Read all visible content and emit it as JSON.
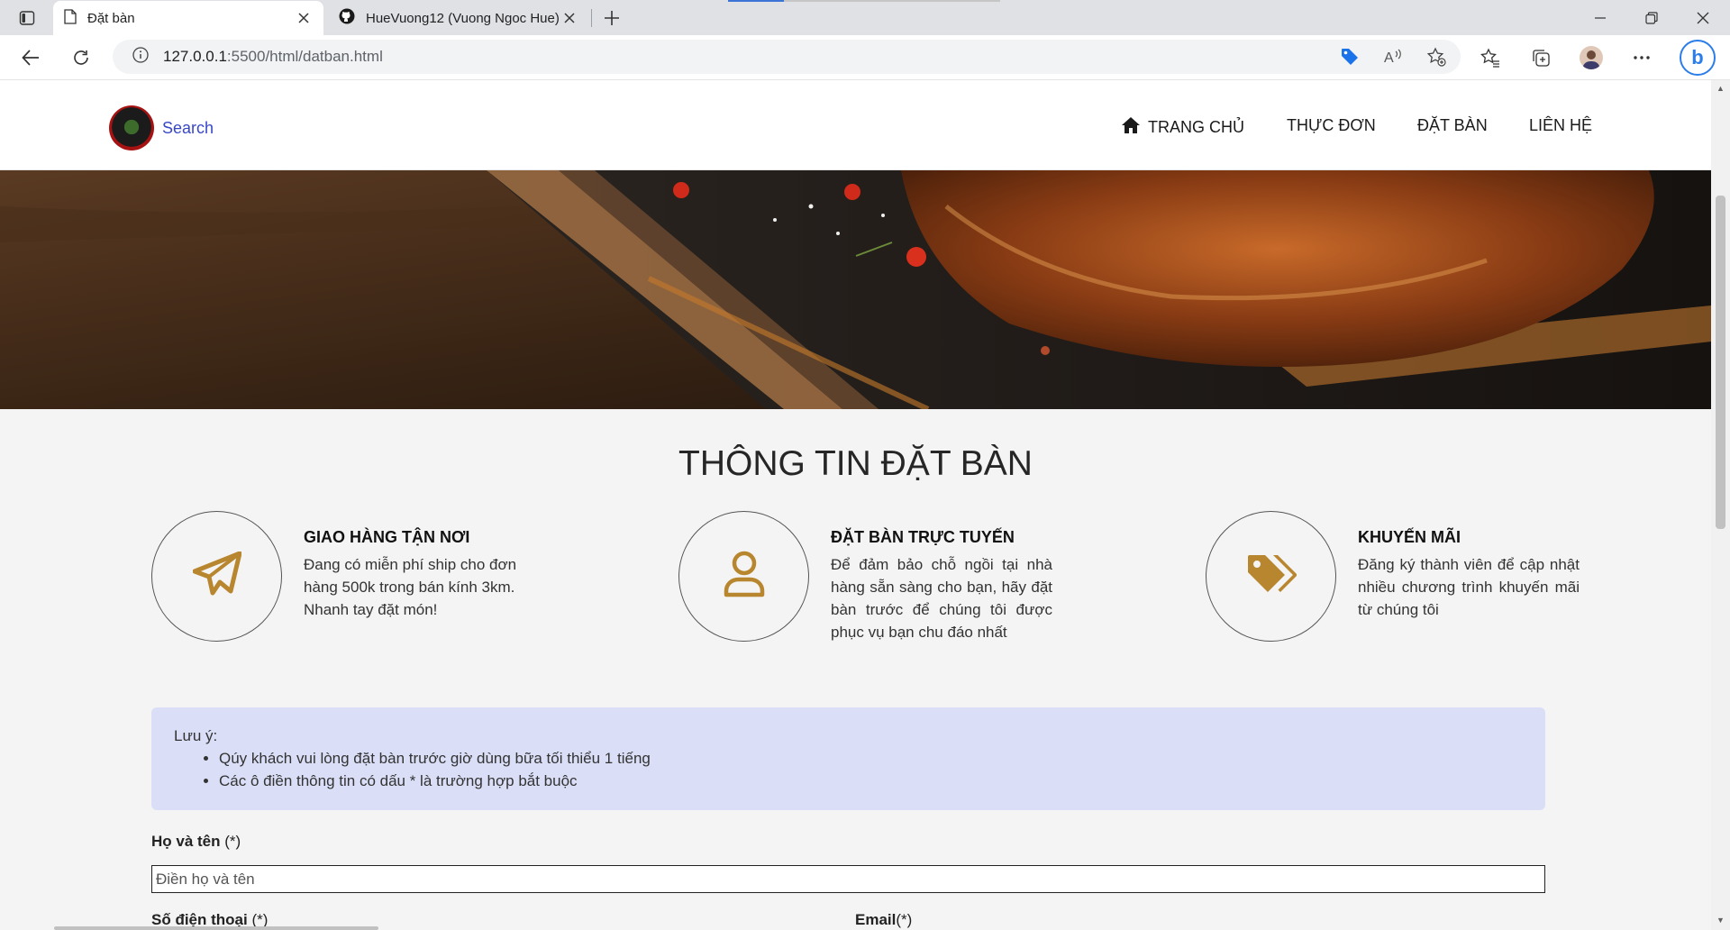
{
  "browser": {
    "tabs": [
      {
        "title": "Đặt bàn",
        "active": true
      },
      {
        "title": "HueVuong12 (Vuong Ngoc Hue)",
        "active": false
      }
    ],
    "url_host": "127.0.0.1",
    "url_path": ":5500/html/datban.html"
  },
  "site": {
    "logo_text": "Search",
    "nav": [
      "TRANG CHỦ",
      "THỰC ĐƠN",
      "ĐẶT BÀN",
      "LIÊN HỆ"
    ]
  },
  "section_title": "THÔNG TIN ĐẶT BÀN",
  "features": [
    {
      "icon": "paper-plane-icon",
      "title": "GIAO HÀNG TẬN NƠI",
      "desc": "Đang có miễn phí ship cho đơn hàng 500k trong bán kính 3km. Nhanh tay đặt món!"
    },
    {
      "icon": "user-icon",
      "title": "ĐẶT BÀN TRỰC TUYẾN",
      "desc": "Để đảm bảo chỗ ngồi tại nhà hàng sẵn sàng cho bạn, hãy đặt bàn trước để chúng tôi được phục vụ bạn chu đáo nhất"
    },
    {
      "icon": "tags-icon",
      "title": "KHUYẾN MÃI",
      "desc": "Đăng ký thành viên để cập nhật nhiều chương trình khuyến mãi từ chúng tôi"
    }
  ],
  "note": {
    "heading": "Lưu ý:",
    "items": [
      "Qúy khách vui lòng đặt bàn trước giờ dùng bữa tối thiểu 1 tiếng",
      "Các ô điền thông tin có dấu * là trường hợp bắt buộc"
    ]
  },
  "form": {
    "name_label": "Họ và tên",
    "name_req": "(*)",
    "name_placeholder": "Điền họ và tên",
    "phone_label": "Số điện thoại",
    "phone_req": "(*)",
    "email_label": "Email",
    "email_req": "(*)"
  },
  "colors": {
    "accent": "#b8862e",
    "note_bg": "#dadff7"
  }
}
